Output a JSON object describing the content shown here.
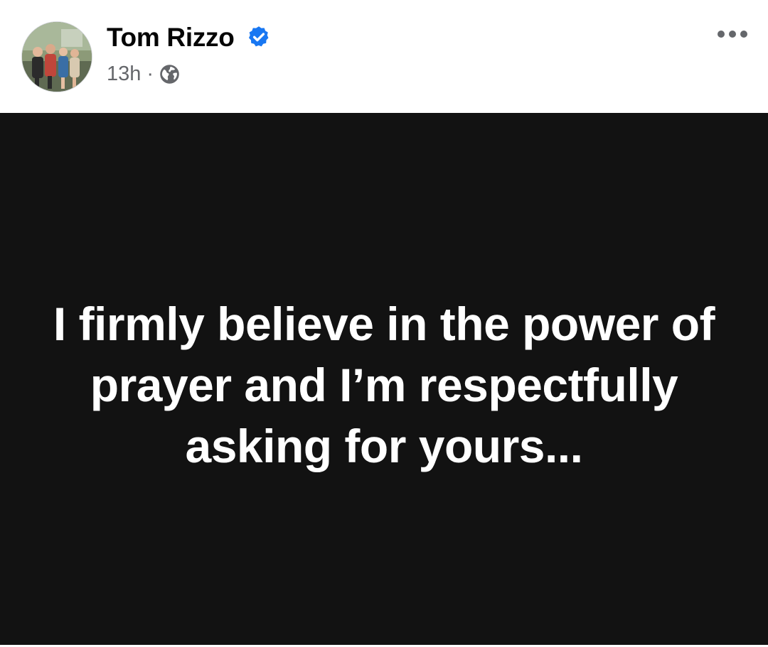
{
  "post": {
    "author": {
      "name": "Tom Rizzo",
      "verified": true,
      "avatar_icon": "profile-photo-group"
    },
    "timestamp": "13h",
    "separator": "·",
    "audience_icon": "globe-icon",
    "more_icon": "more-horizontal-icon",
    "text": "I firmly believe in the power of prayer and I’m respectfully asking for yours...",
    "background_color": "#121212",
    "text_color": "#ffffff",
    "verified_color": "#1877f2"
  }
}
